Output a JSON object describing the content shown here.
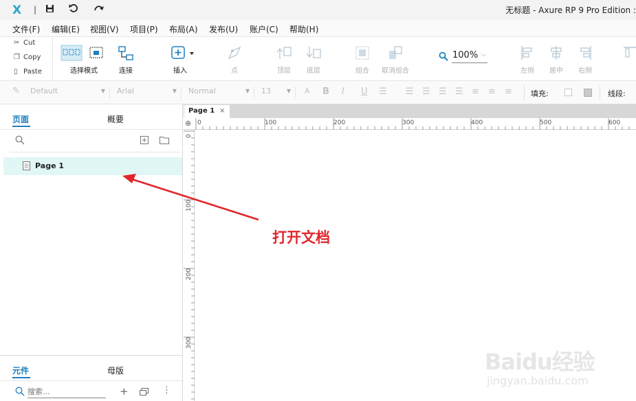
{
  "titlebar": {
    "logo": "X",
    "separator": "|",
    "title": "无标题 - Axure RP 9 Pro Edition :"
  },
  "menubar": {
    "items": [
      "文件(F)",
      "编辑(E)",
      "视图(V)",
      "项目(P)",
      "布局(A)",
      "发布(U)",
      "账户(C)",
      "帮助(H)"
    ]
  },
  "clipboard": {
    "cut": "Cut",
    "copy": "Copy",
    "paste": "Paste"
  },
  "toolbar": {
    "select_mode": "选择模式",
    "connect": "连接",
    "insert": "插入",
    "point": "点",
    "top_layer": "顶层",
    "bottom_layer": "底层",
    "group": "组合",
    "ungroup": "取消组合",
    "zoom": "100%",
    "align_left": "左侧",
    "align_center": "居中",
    "align_right": "右侧",
    "align_top": "顶"
  },
  "formatbar": {
    "style": "Default",
    "font": "Arial",
    "weight": "Normal",
    "size": "13",
    "fill_label": "填充:",
    "stroke_label": "线段:"
  },
  "left_panel": {
    "tabs": [
      "页面",
      "概要"
    ],
    "pages": [
      {
        "label": "Page 1"
      }
    ],
    "bottom_tabs": [
      "元件",
      "母版"
    ],
    "search_placeholder": "搜索..."
  },
  "document": {
    "tab_label": "Page 1",
    "ruler_top": [
      "0",
      "100",
      "200",
      "300",
      "400",
      "500",
      "600"
    ],
    "ruler_left": [
      "0",
      "100",
      "200",
      "300"
    ]
  },
  "annotation": {
    "text": "打开文档",
    "color": "#e0262c"
  },
  "watermark": {
    "brand": "Baidu经验",
    "url": "jingyan.baidu.com"
  },
  "colors": {
    "accent": "#1d7fbf",
    "page_highlight": "#e1f7f6",
    "logo": "#2aa7c8"
  }
}
